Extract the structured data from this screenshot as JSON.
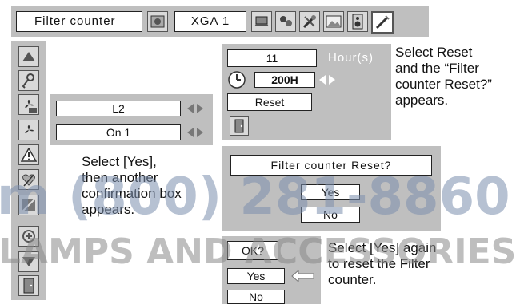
{
  "menu_bar": {
    "title": "Filter counter",
    "input_label": "XGA 1",
    "icons": [
      "fan-filter-icon",
      "laptop-icon",
      "people-icon",
      "tools-icon",
      "picture-icon",
      "speaker-icon",
      "pencil-setting-icon"
    ]
  },
  "sidebar": {
    "icons": [
      "triangle-up-icon",
      "key-icon",
      "fan-off-icon",
      "fan-icon",
      "warning-icon",
      "heart-icon",
      "picture-grid-icon",
      "swirl-icon",
      "triangle-down-icon",
      "exit-icon"
    ]
  },
  "mid_panel": {
    "row1_value": "L2",
    "row2_value": "On 1"
  },
  "hour_panel": {
    "hours_value": "11",
    "hours_unit": "Hour(s)",
    "interval_value": "200H",
    "reset_label": "Reset"
  },
  "reset_dialog": {
    "question": "Filter counter Reset?",
    "yes_label": "Yes",
    "no_label": "No"
  },
  "ok_dialog": {
    "question": "OK?",
    "yes_label": "Yes",
    "no_label": "No"
  },
  "annotations": {
    "top_right": [
      "Select Reset",
      "and the “Filter",
      "counter Reset?”",
      "appears."
    ],
    "middle_left": [
      "Select [Yes],",
      "then another",
      "confirmation box",
      "appears."
    ],
    "bottom_right": [
      "Select [Yes] again",
      "to reset the Filter",
      "counter."
    ]
  },
  "watermark": {
    "phone": "m (800) 281-8860",
    "company": "LAMPS AND ACCESSORIES"
  },
  "colors": {
    "panel": "#bfbfbf",
    "arrow": "#707070",
    "watermark_blue": "#7c8fae"
  }
}
